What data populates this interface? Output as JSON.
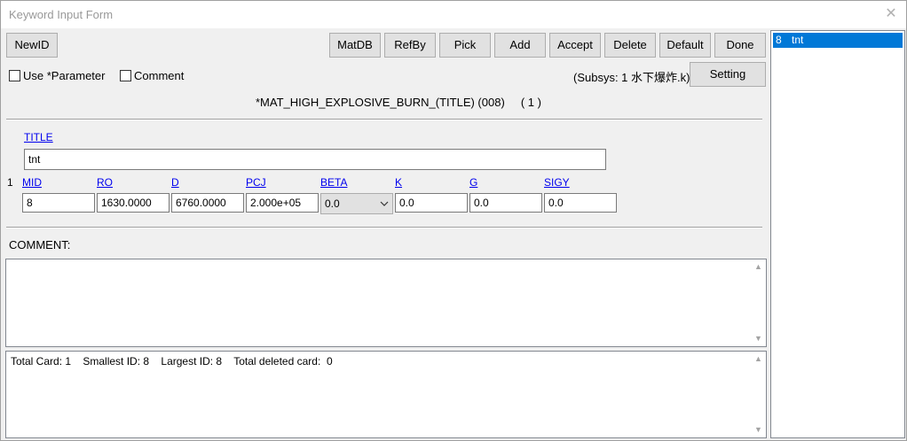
{
  "window": {
    "title": "Keyword Input Form",
    "close_glyph": "✕"
  },
  "toolbar": {
    "newid_label": "NewID",
    "matdb_label": "MatDB",
    "refby_label": "RefBy",
    "pick_label": "Pick",
    "add_label": "Add",
    "accept_label": "Accept",
    "delete_label": "Delete",
    "default_label": "Default",
    "done_label": "Done"
  },
  "options": {
    "use_parameter_label": "Use *Parameter",
    "comment_label": "Comment",
    "subsys_text": "(Subsys: 1 水下爆炸.k)",
    "setting_label": "Setting"
  },
  "keyword": {
    "header": "*MAT_HIGH_EXPLOSIVE_BURN_(TITLE) (008)     ( 1 )"
  },
  "title_card": {
    "label": "TITLE",
    "value": "tnt"
  },
  "card1": {
    "row_number": "1",
    "fields": [
      {
        "label": "MID",
        "value": "8"
      },
      {
        "label": "RO",
        "value": "1630.0000"
      },
      {
        "label": "D",
        "value": "6760.0000"
      },
      {
        "label": "PCJ",
        "value": "2.000e+05"
      },
      {
        "label": "BETA",
        "value": "0.0"
      },
      {
        "label": "K",
        "value": "0.0"
      },
      {
        "label": "G",
        "value": "0.0"
      },
      {
        "label": "SIGY",
        "value": "0.0"
      }
    ]
  },
  "comment_section": {
    "label": "COMMENT:"
  },
  "status": {
    "text": "Total Card: 1    Smallest ID: 8    Largest ID: 8    Total deleted card:  0"
  },
  "id_list": {
    "items": [
      {
        "id": "8",
        "name": "tnt"
      }
    ]
  },
  "colors": {
    "selection": "#0078d7",
    "link": "#0000ee",
    "button_bg": "#e1e1e1"
  }
}
